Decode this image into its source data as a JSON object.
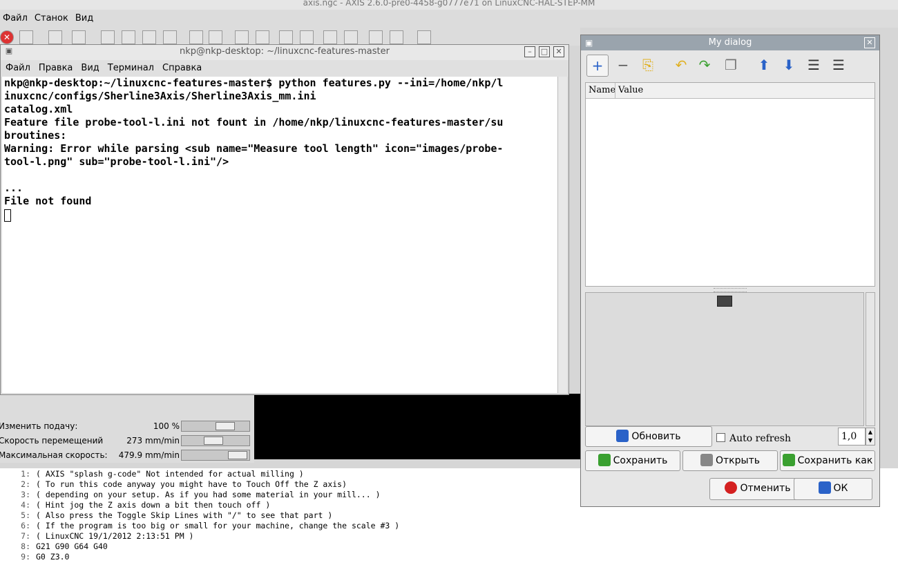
{
  "axis": {
    "title": "axis.ngc - AXIS 2.6.0-pre0-4458-g0777e71 on LinuxCNC-HAL-STEP-MM",
    "menu": [
      "Файл",
      "Станок",
      "Вид"
    ],
    "overrides": [
      {
        "label": "Изменить подачу:",
        "value": "100 %",
        "level": 0.7
      },
      {
        "label": "Скорость перемещений",
        "value": "273 mm/min",
        "level": 0.45
      },
      {
        "label": "Максимальная скорость:",
        "value": "479.9 mm/min",
        "level": 0.95
      }
    ],
    "gcode": [
      {
        "n": "1:",
        "text": "( AXIS \"splash g-code\" Not intended for actual milling )"
      },
      {
        "n": "2:",
        "text": "( To run this code anyway you might have to Touch Off the Z axis)"
      },
      {
        "n": "3:",
        "text": "( depending on your setup. As if you had some material in your mill... )"
      },
      {
        "n": "4:",
        "text": "( Hint jog the Z axis down a bit then touch off )"
      },
      {
        "n": "5:",
        "text": "( Also press the Toggle Skip Lines with \"/\" to see that part )"
      },
      {
        "n": "6:",
        "text": "( If the program is too big or small for your machine, change the scale #3 )"
      },
      {
        "n": "7:",
        "text": "( LinuxCNC 19/1/2012 2:13:51 PM )"
      },
      {
        "n": "8:",
        "text": "G21 G90 G64 G40"
      },
      {
        "n": "9:",
        "text": "G0 Z3.0"
      }
    ]
  },
  "terminal": {
    "title": "nkp@nkp-desktop: ~/linuxcnc-features-master",
    "menu": [
      "Файл",
      "Правка",
      "Вид",
      "Терминал",
      "Справка"
    ],
    "lines": [
      "nkp@nkp-desktop:~/linuxcnc-features-master$ python features.py --ini=/home/nkp/l",
      "inuxcnc/configs/Sherline3Axis/Sherline3Axis_mm.ini",
      "catalog.xml",
      "Feature file probe-tool-l.ini not fount in /home/nkp/linuxcnc-features-master/su",
      "broutines:",
      "Warning: Error while parsing <sub name=\"Measure tool length\" icon=\"images/probe-",
      "tool-l.png\" sub=\"probe-tool-l.ini\"/>",
      "",
      "...",
      "File not found"
    ]
  },
  "dialog": {
    "title": "My dialog",
    "columns": [
      "Name",
      "Value"
    ],
    "refresh_label": "Обновить",
    "auto_refresh_label": "Auto refresh",
    "auto_refresh_checked": false,
    "interval_value": "1,0",
    "save_label": "Сохранить",
    "open_label": "Открыть",
    "save_as_label": "Сохранить как",
    "cancel_label": "Отменить",
    "ok_label": "ОК"
  },
  "colors": {
    "accent": "#9aa4ad",
    "cancel_red": "#d42020",
    "arrow_blue": "#2a62c8",
    "undo_yellow": "#e0b020",
    "redo_green": "#3aa030"
  }
}
